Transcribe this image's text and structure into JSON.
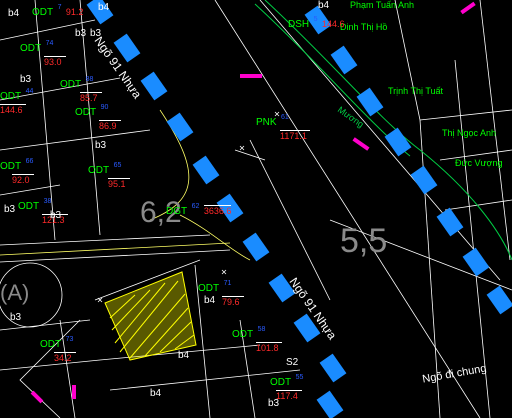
{
  "colors": {
    "background": "#000000",
    "road_block": "#1a8cff",
    "odt_label": "#00ff00",
    "area_value": "#ff2a2a",
    "parcel_number": "#2a5bff",
    "block_code": "#ffffff",
    "zone_number": "#8a8a8a",
    "road_name": "#ffffff",
    "highlight_fill": "#ffff00",
    "magenta_mark": "#ff00cc",
    "outline": "#ffffff",
    "edge_line": "#ffff66"
  },
  "labels": {
    "road_upper": "Ngõ 91 Nhựa",
    "road_lower": "Ngõ 91 Nhựa",
    "alley": "Ngõ đi chung",
    "zone_left": "6,2",
    "zone_right": "5,5",
    "river_text": "Mương",
    "name_top": "Phạm Tuấn Anh",
    "name_mid1": "Đinh Thị Hồ",
    "name_mid2": "Trịnh Thị Tuất",
    "name_mid3": "Thị Ngọc Anh",
    "name_far": "Đức Vượng"
  },
  "parcels": [
    {
      "code": "ODT",
      "num": "74",
      "area": "93.0",
      "block": "b3"
    },
    {
      "code": "ODT",
      "num": "88",
      "area": "85.7",
      "block": "b3"
    },
    {
      "code": "ODT",
      "num": "90",
      "area": "86.9",
      "block": "b3"
    },
    {
      "code": "ODT",
      "num": "44",
      "area": "144.6",
      "block": "b4"
    },
    {
      "code": "ODT",
      "num": "66",
      "area": "92.0",
      "block": "b3"
    },
    {
      "code": "ODT",
      "num": "65",
      "area": "95.1",
      "block": "b3"
    },
    {
      "code": "ODT",
      "num": "38",
      "area": "121.3",
      "block": "b3"
    },
    {
      "code": "PNK",
      "num": "61",
      "area": "1171.1",
      "block": ""
    },
    {
      "code": "DGT",
      "num": "62",
      "area": "3636.6",
      "block": ""
    },
    {
      "code": "ODT",
      "num": "71",
      "area": "79.6",
      "block": "b4"
    },
    {
      "code": "ODT",
      "num": "58",
      "area": "101.8",
      "block": "b4"
    },
    {
      "code": "ODT",
      "num": "55",
      "area": "117.4",
      "block": "b4"
    },
    {
      "code": "ODT",
      "num": "73",
      "area": "34.2",
      "block": "b3"
    },
    {
      "code": "DSH",
      "num": "5",
      "area": "144.6",
      "block": "b4"
    },
    {
      "code": "ODT",
      "num": "7",
      "area": "91.2",
      "block": "b4"
    }
  ],
  "misc_text": {
    "b4_top": "b4",
    "b3_top": "b3",
    "s2": "S2",
    "a_label": "(A)",
    "s2b": "b3"
  }
}
